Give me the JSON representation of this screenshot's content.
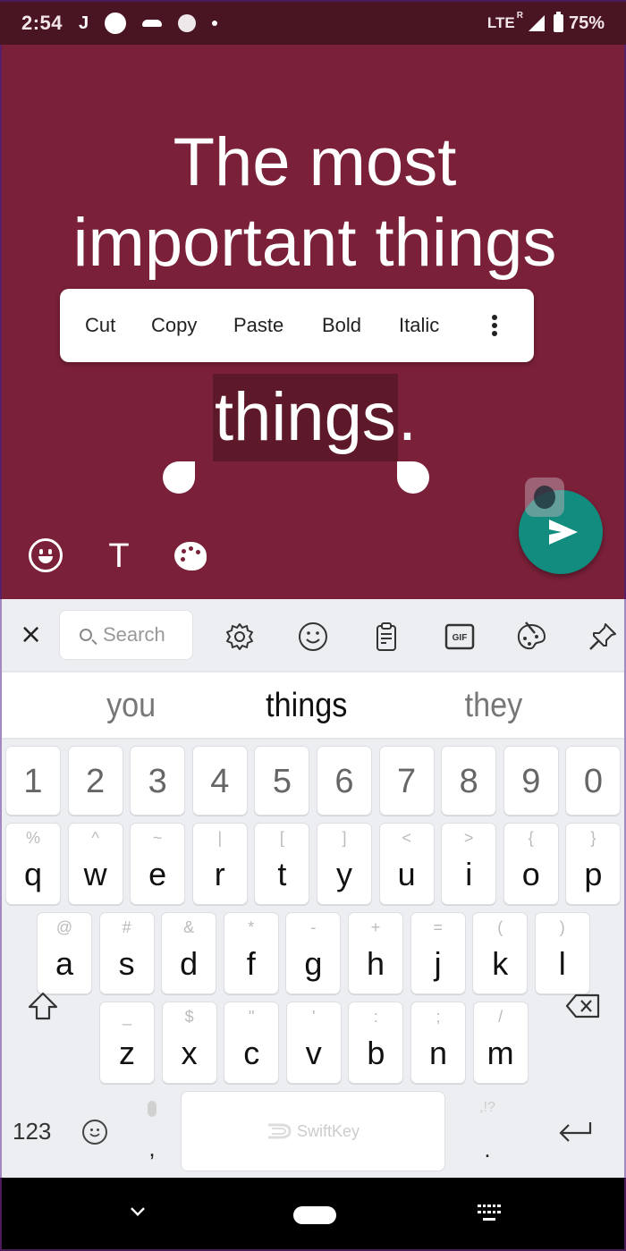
{
  "status_bar": {
    "time": "2:54",
    "notification_icons": [
      "j-app-icon",
      "circle-icon",
      "mustache-icon",
      "aperture-icon",
      "dot-icon"
    ],
    "network": "LTE",
    "roaming": "R",
    "battery": "75%"
  },
  "story": {
    "background_color": "#7a2039",
    "lines": [
      "The most",
      "important things"
    ],
    "selected_word": "things",
    "after_selection": "."
  },
  "context_menu": {
    "items": [
      "Cut",
      "Copy",
      "Paste",
      "Bold",
      "Italic"
    ],
    "more": "more-options-icon"
  },
  "bottom_tools": {
    "emoji": "emoji-icon",
    "text": "T",
    "palette": "palette-icon"
  },
  "fab": {
    "color": "#118c7e",
    "icon": "send-icon"
  },
  "keyboard": {
    "toolbar": {
      "close": "×",
      "search_placeholder": "Search",
      "gif_label": "GIF"
    },
    "suggestions": [
      "you",
      "things",
      "they"
    ],
    "number_row": [
      "1",
      "2",
      "3",
      "4",
      "5",
      "6",
      "7",
      "8",
      "9",
      "0"
    ],
    "row1": [
      {
        "main": "q",
        "alt": "%"
      },
      {
        "main": "w",
        "alt": "^"
      },
      {
        "main": "e",
        "alt": "~"
      },
      {
        "main": "r",
        "alt": "|"
      },
      {
        "main": "t",
        "alt": "["
      },
      {
        "main": "y",
        "alt": "]"
      },
      {
        "main": "u",
        "alt": "<"
      },
      {
        "main": "i",
        "alt": ">"
      },
      {
        "main": "o",
        "alt": "{"
      },
      {
        "main": "p",
        "alt": "}"
      }
    ],
    "row2": [
      {
        "main": "a",
        "alt": "@"
      },
      {
        "main": "s",
        "alt": "#"
      },
      {
        "main": "d",
        "alt": "&"
      },
      {
        "main": "f",
        "alt": "*"
      },
      {
        "main": "g",
        "alt": "-"
      },
      {
        "main": "h",
        "alt": "+"
      },
      {
        "main": "j",
        "alt": "="
      },
      {
        "main": "k",
        "alt": "("
      },
      {
        "main": "l",
        "alt": ")"
      }
    ],
    "row3": [
      {
        "main": "z",
        "alt": "_"
      },
      {
        "main": "x",
        "alt": "$"
      },
      {
        "main": "c",
        "alt": "\""
      },
      {
        "main": "v",
        "alt": "'"
      },
      {
        "main": "b",
        "alt": ":"
      },
      {
        "main": "n",
        "alt": ";"
      },
      {
        "main": "m",
        "alt": "/"
      }
    ],
    "bottom": {
      "numbers_label": "123",
      "comma": ",",
      "space_brand": "SwiftKey",
      "period": ".",
      "period_alt": ",!?"
    }
  }
}
